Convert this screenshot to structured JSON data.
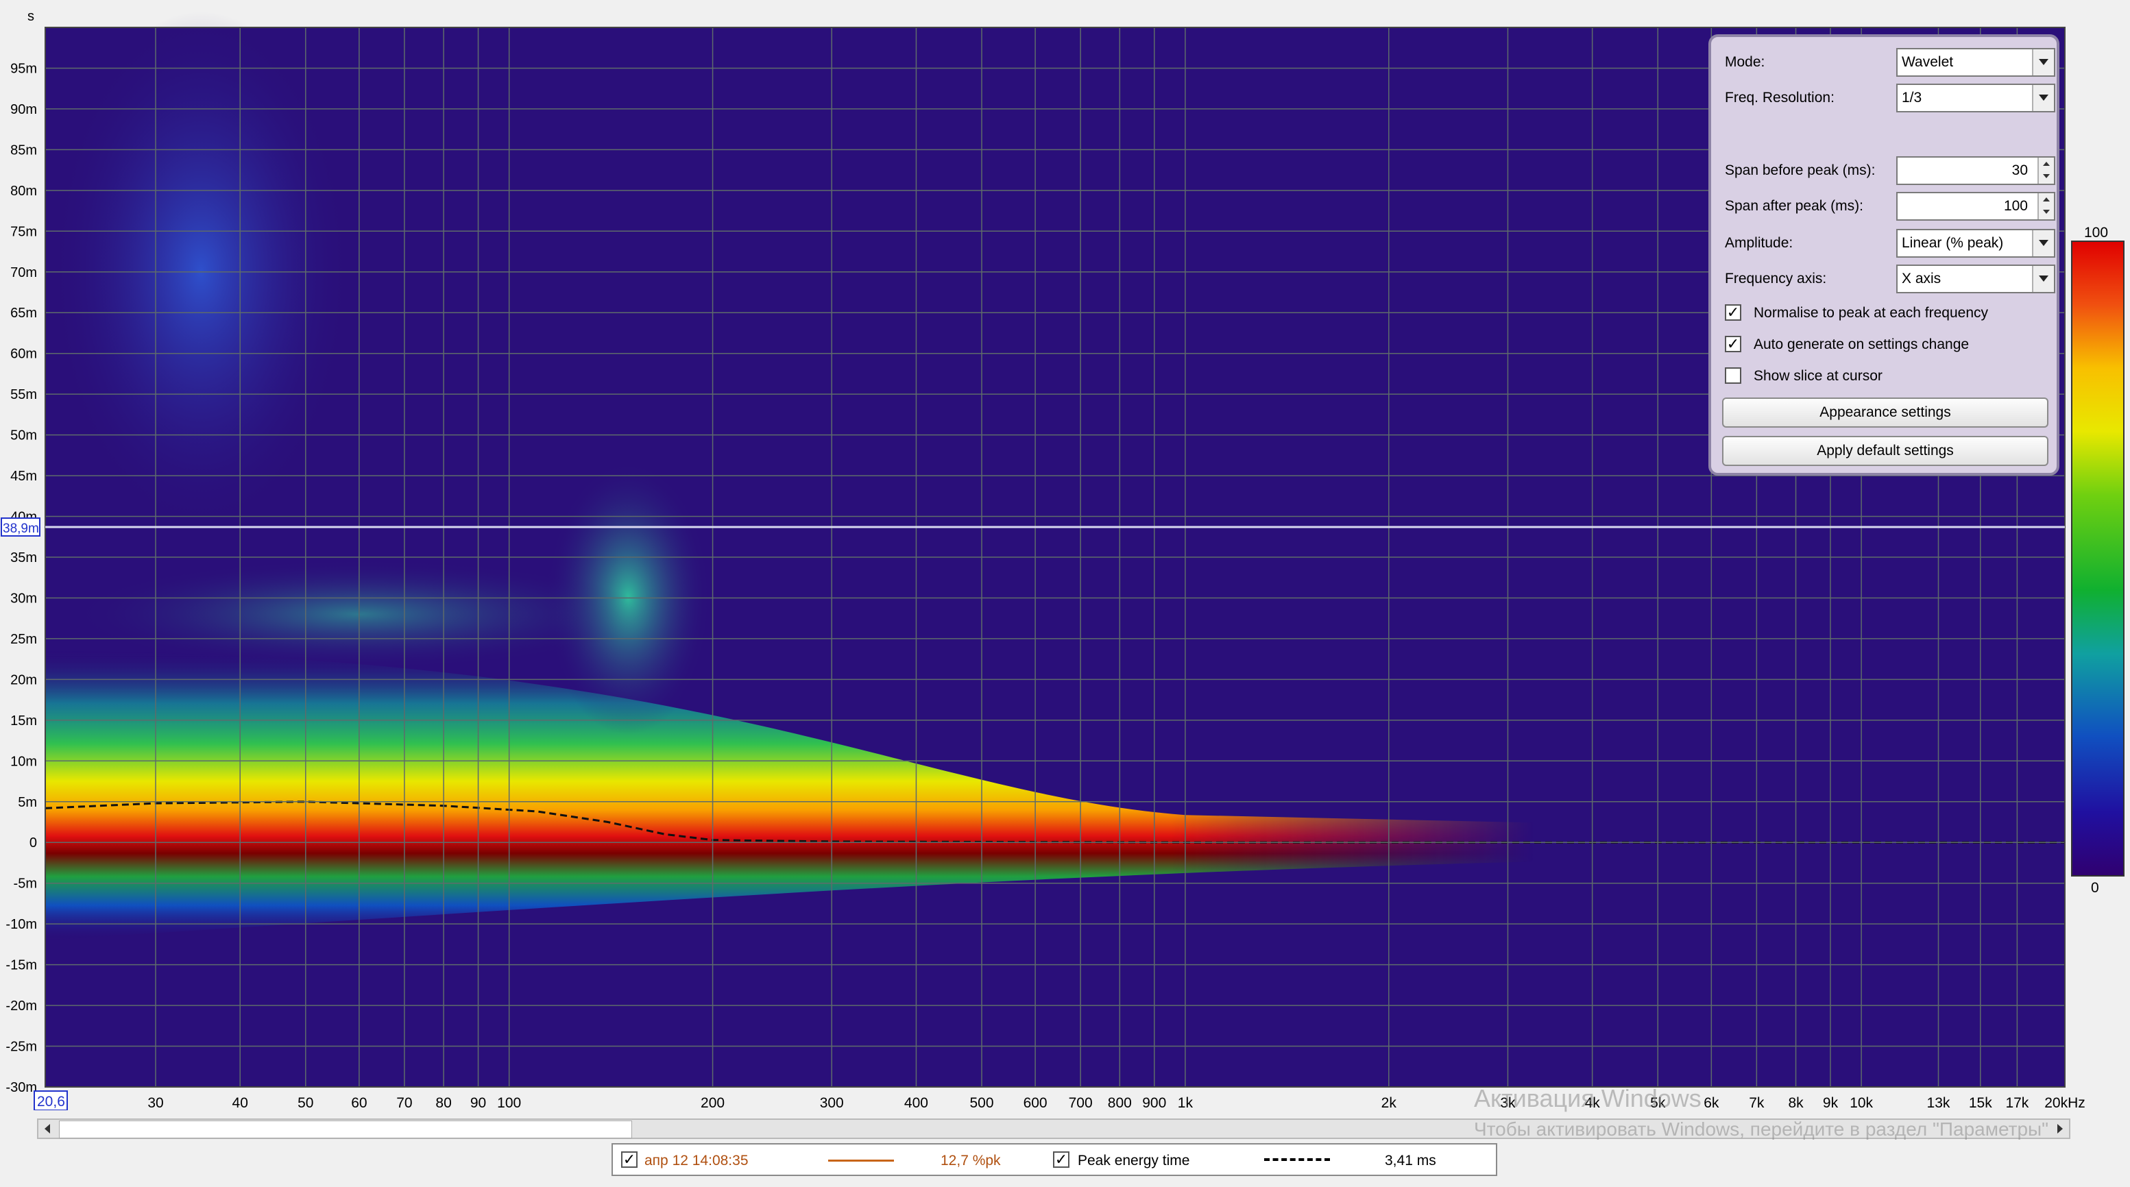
{
  "plot": {
    "y_unit": "s",
    "y_ticks": [
      "95m",
      "90m",
      "85m",
      "80m",
      "75m",
      "70m",
      "65m",
      "60m",
      "55m",
      "50m",
      "45m",
      "40m",
      "35m",
      "30m",
      "25m",
      "20m",
      "15m",
      "10m",
      "5m",
      "0",
      "-5m",
      "-10m",
      "-15m",
      "-20m",
      "-25m",
      "-30m"
    ],
    "x_ticks": [
      "30",
      "40",
      "50",
      "60",
      "70",
      "80",
      "90",
      "100",
      "200",
      "300",
      "400",
      "500",
      "600",
      "700",
      "800",
      "900",
      "1k",
      "2k",
      "3k",
      "4k",
      "5k",
      "6k",
      "7k",
      "8k",
      "9k",
      "10k",
      "13k",
      "15k",
      "17k",
      "20kHz"
    ],
    "x_start_label": "20,6",
    "cursor_label": "38,9m",
    "colorbar_top": "100",
    "colorbar_bottom": "0",
    "colors": {
      "background": "#2a0f7a",
      "grid": "#5e6b6b",
      "cursor": "#d8d8f0",
      "accent": "#2233cc"
    }
  },
  "panel": {
    "mode_label": "Mode:",
    "mode_value": "Wavelet",
    "freq_res_label": "Freq. Resolution:",
    "freq_res_value": "1/3",
    "span_before_label": "Span before peak (ms):",
    "span_before_value": "30",
    "span_after_label": "Span after peak (ms):",
    "span_after_value": "100",
    "amplitude_label": "Amplitude:",
    "amplitude_value": "Linear (% peak)",
    "freq_axis_label": "Frequency axis:",
    "freq_axis_value": "X axis",
    "normalise_label": "Normalise to peak at each frequency",
    "normalise_checked": true,
    "autogen_label": "Auto generate on settings change",
    "autogen_checked": true,
    "slice_label": "Show slice at cursor",
    "slice_checked": false,
    "appearance_button": "Appearance settings",
    "defaults_button": "Apply default settings"
  },
  "legend": {
    "item1_name": "апр 12 14:08:35",
    "item1_value": "12,7 %pk",
    "item1_color": "#c86418",
    "item2_name": "Peak energy time",
    "item2_value": "3,41 ms",
    "check_mark": "✓"
  },
  "watermark": {
    "line1": "Активация Windows",
    "line2": "Чтобы активировать Windows, перейдите в раздел \"Параметры\""
  }
}
